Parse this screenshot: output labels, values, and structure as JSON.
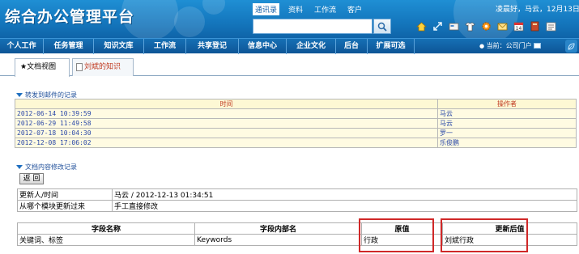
{
  "header": {
    "logo": "综合办公管理平台",
    "top_tabs": [
      "通讯录",
      "资料",
      "工作流",
      "客户"
    ],
    "search_placeholder": "",
    "greeting": "凌晨好，马云，12月13日，",
    "tool_icons": [
      "home-icon",
      "resize-icon",
      "card-icon",
      "shirt-icon",
      "gear-icon",
      "mail-icon",
      "calendar-icon",
      "book-icon",
      "news-icon"
    ]
  },
  "nav": {
    "items": [
      "个人工作",
      "任务管理",
      "知识文库",
      "工作流",
      "共享登记",
      "信息中心",
      "企业文化",
      "后台",
      "扩展可选"
    ],
    "current": "当前：公司门户"
  },
  "tabs": [
    {
      "label": "★文档视图"
    },
    {
      "label": "刘斌的知识"
    }
  ],
  "forward_section": {
    "title": "转发到邮件的记录",
    "columns": [
      "时间",
      "操作者"
    ],
    "rows": [
      {
        "time": "2012-06-14 10:39:59",
        "operator": "马云"
      },
      {
        "time": "2012-06-29 11:49:58",
        "operator": "马云"
      },
      {
        "time": "2012-07-18 10:04:30",
        "operator": "罗一"
      },
      {
        "time": "2012-12-08 17:06:02",
        "operator": "乐俊鹏"
      }
    ]
  },
  "modify_section": {
    "title": "文档内容修改记录",
    "back_label": "返 回",
    "info": {
      "updater_label": "更新人/时间",
      "updater_value": "马云 / 2012-12-13 01:34:51",
      "module_label": "从哪个模块更新过来",
      "module_value": "手工直接修改"
    },
    "columns": [
      "字段名称",
      "字段内部名",
      "原值",
      "更新后值"
    ],
    "rows": [
      {
        "field": "关键词、标签",
        "internal": "Keywords",
        "old": "行政",
        "new": "刘斌行政"
      }
    ]
  },
  "colors": {
    "header_blue": "#1476bd",
    "nav_blue": "#0d5596",
    "highlight_red": "#d02828"
  }
}
